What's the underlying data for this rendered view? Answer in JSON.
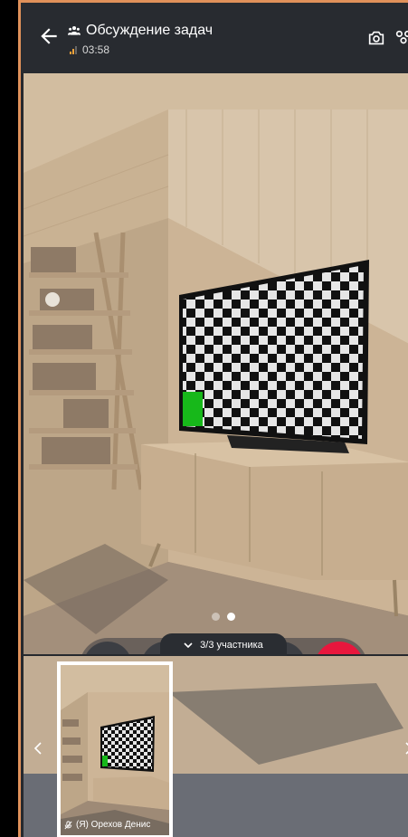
{
  "header": {
    "title": "Обсуждение задач",
    "timer": "03:58"
  },
  "call": {
    "participants_label": "3/3 участника",
    "carousel_pages": 2,
    "active_page": 1
  },
  "thumbnail": {
    "name": "(Я) Орехов Денис"
  },
  "colors": {
    "accent_end_call": "#e8173d",
    "header_bg": "#282b30",
    "frame_border": "#e0915a",
    "signal_active": "#f2a23a"
  },
  "icons": [
    "back-arrow-icon",
    "group-icon",
    "signal-icon",
    "camera-switch-icon",
    "participants-icon",
    "more-icon",
    "video-camera-icon",
    "speaker-icon",
    "mic-off-icon",
    "hang-up-icon",
    "chevron-down-icon",
    "chevron-left-icon",
    "chevron-right-icon"
  ]
}
